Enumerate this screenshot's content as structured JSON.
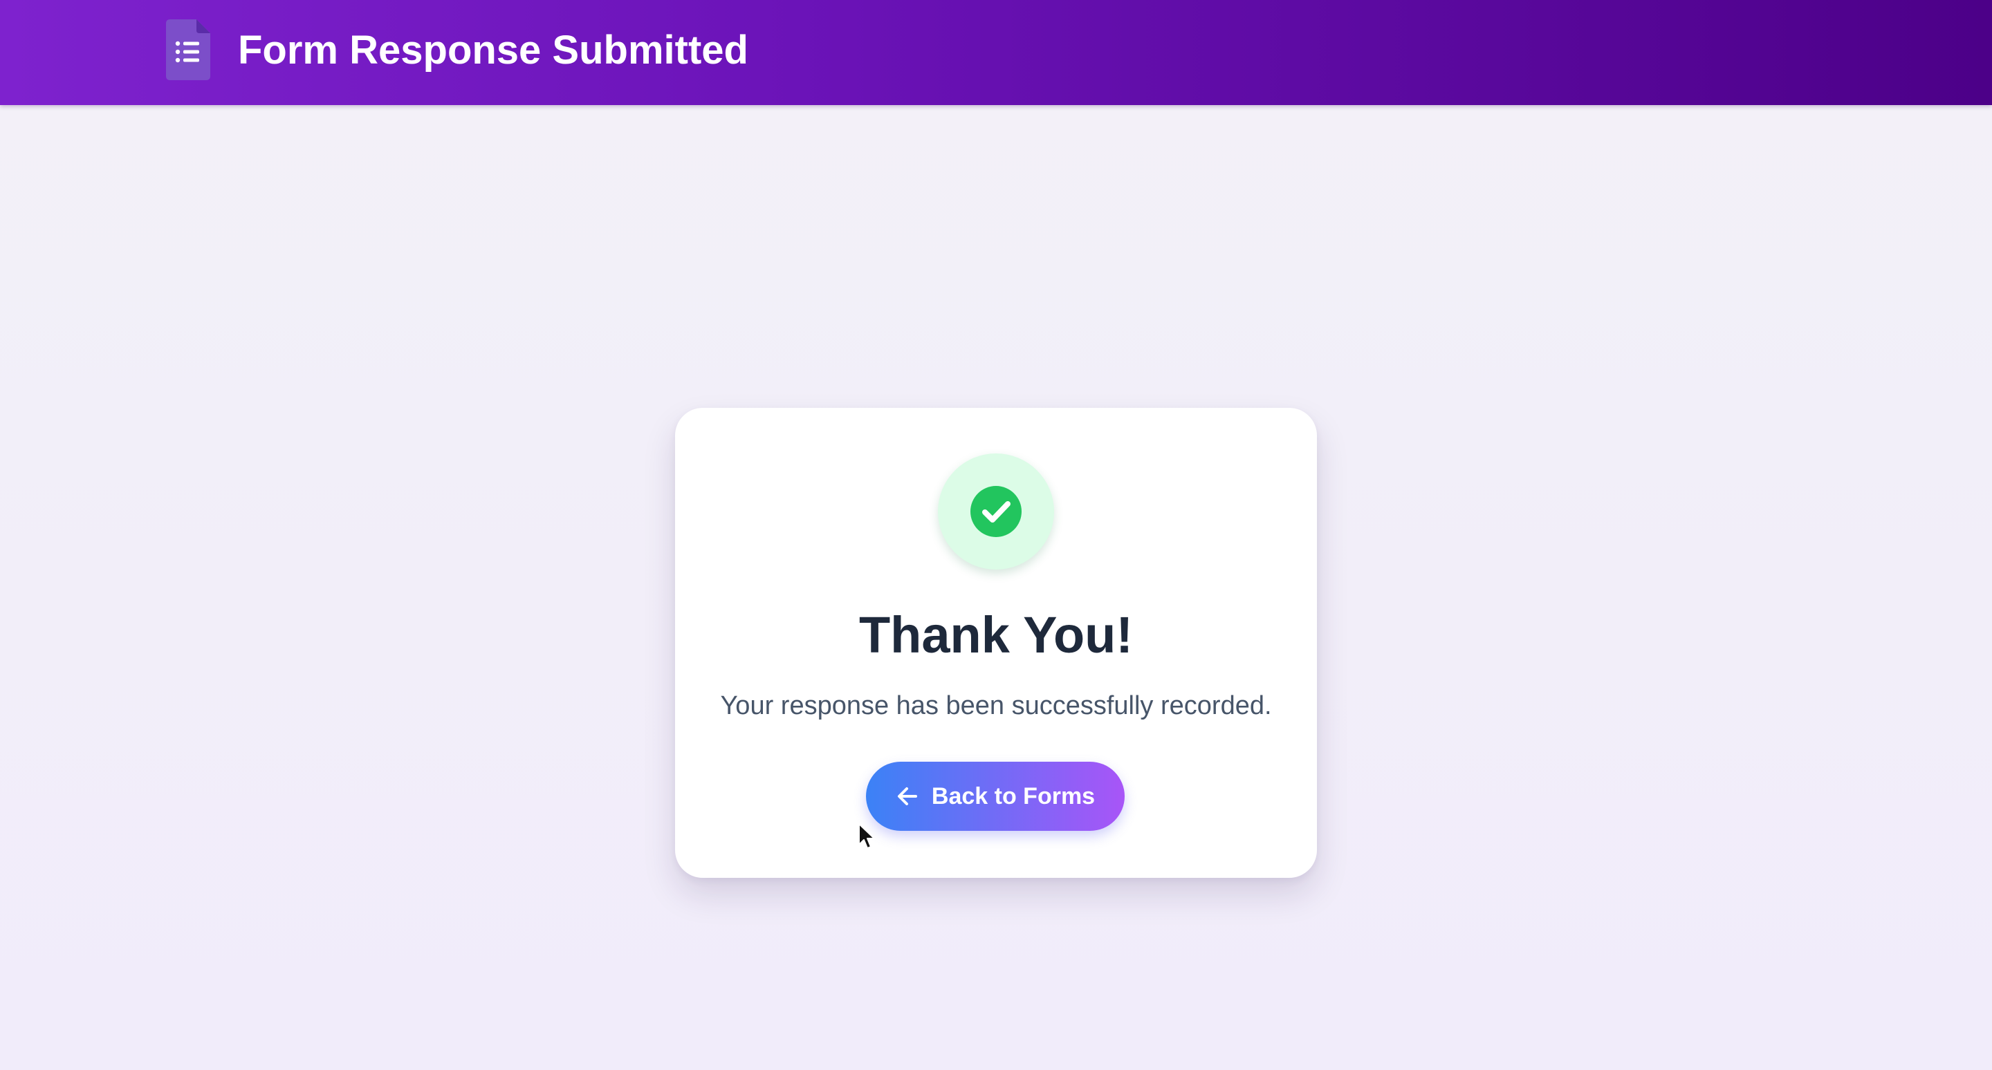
{
  "header": {
    "title": "Form Response Submitted",
    "icon": "form-list-icon",
    "colors": {
      "gradient_start": "#7e22ce",
      "gradient_end": "#4c0088"
    }
  },
  "confirmation": {
    "status_icon": "check-circle-icon",
    "title": "Thank You!",
    "message": "Your response has been successfully recorded.",
    "back_button": {
      "label": "Back to Forms",
      "icon": "arrow-left-icon"
    },
    "colors": {
      "success_bg": "#dcfce7",
      "success": "#22c55e",
      "button_gradient_start": "#3b82f6",
      "button_gradient_end": "#a855f7"
    }
  }
}
